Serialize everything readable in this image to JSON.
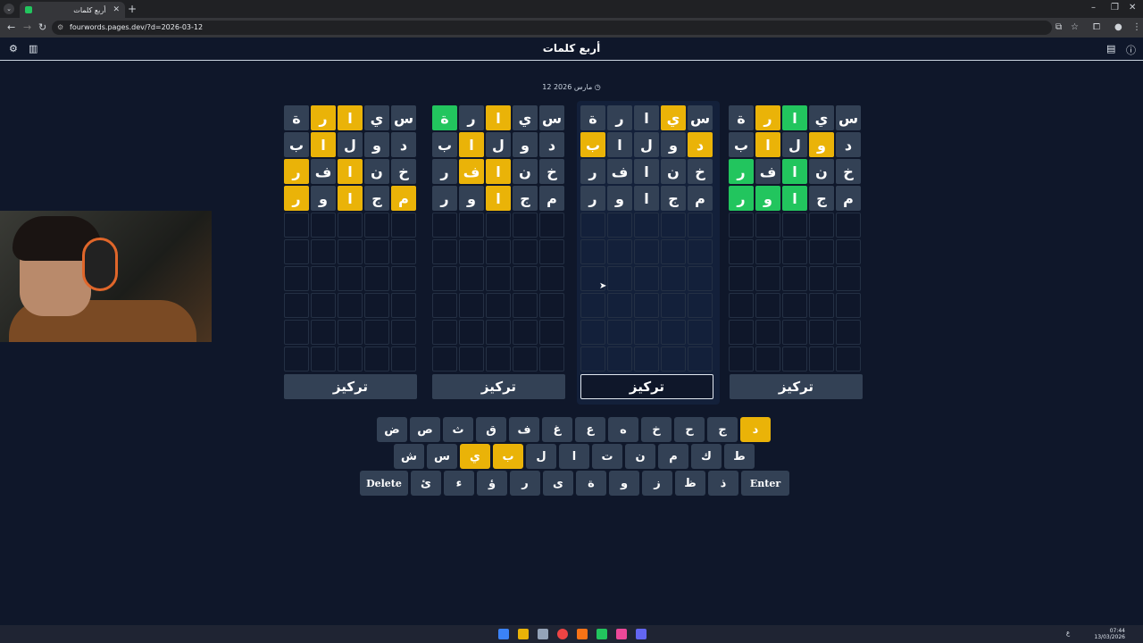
{
  "browser": {
    "tab_title": "أربع كلمات",
    "tab_close": "✕",
    "new_tab": "+",
    "tab_list": "⌄",
    "url": "fourwords.pages.dev/?d=2026-03-12",
    "minimize": "–",
    "restore": "❐",
    "close": "✕"
  },
  "app": {
    "title": "أربع كلمات",
    "date": "12 مارس 2026",
    "focus_label": "تركيز"
  },
  "colors": {
    "green": "#22c55e",
    "yellow": "#eab308",
    "gray": "#334155",
    "bg": "#0f172a"
  },
  "boards": [
    {
      "rows": [
        [
          [
            "س",
            "n"
          ],
          [
            "ي",
            "n"
          ],
          [
            "ا",
            "y"
          ],
          [
            "ر",
            "y"
          ],
          [
            "ة",
            "n"
          ]
        ],
        [
          [
            "د",
            "n"
          ],
          [
            "و",
            "n"
          ],
          [
            "ل",
            "n"
          ],
          [
            "ا",
            "y"
          ],
          [
            "ب",
            "n"
          ]
        ],
        [
          [
            "خ",
            "n"
          ],
          [
            "ن",
            "n"
          ],
          [
            "ا",
            "y"
          ],
          [
            "ف",
            "n"
          ],
          [
            "ر",
            "y"
          ]
        ],
        [
          [
            "م",
            "y"
          ],
          [
            "ج",
            "n"
          ],
          [
            "ا",
            "y"
          ],
          [
            "و",
            "n"
          ],
          [
            "ر",
            "y"
          ]
        ]
      ]
    },
    {
      "rows": [
        [
          [
            "س",
            "n"
          ],
          [
            "ي",
            "n"
          ],
          [
            "ا",
            "y"
          ],
          [
            "ر",
            "n"
          ],
          [
            "ة",
            "g"
          ]
        ],
        [
          [
            "د",
            "n"
          ],
          [
            "و",
            "n"
          ],
          [
            "ل",
            "n"
          ],
          [
            "ا",
            "y"
          ],
          [
            "ب",
            "n"
          ]
        ],
        [
          [
            "خ",
            "n"
          ],
          [
            "ن",
            "n"
          ],
          [
            "ا",
            "y"
          ],
          [
            "ف",
            "y"
          ],
          [
            "ر",
            "n"
          ]
        ],
        [
          [
            "م",
            "n"
          ],
          [
            "ج",
            "n"
          ],
          [
            "ا",
            "y"
          ],
          [
            "و",
            "n"
          ],
          [
            "ر",
            "n"
          ]
        ]
      ]
    },
    {
      "rows": [
        [
          [
            "س",
            "n"
          ],
          [
            "ي",
            "y"
          ],
          [
            "ا",
            "n"
          ],
          [
            "ر",
            "n"
          ],
          [
            "ة",
            "n"
          ]
        ],
        [
          [
            "د",
            "y"
          ],
          [
            "و",
            "n"
          ],
          [
            "ل",
            "n"
          ],
          [
            "ا",
            "n"
          ],
          [
            "ب",
            "y"
          ]
        ],
        [
          [
            "خ",
            "n"
          ],
          [
            "ن",
            "n"
          ],
          [
            "ا",
            "n"
          ],
          [
            "ف",
            "n"
          ],
          [
            "ر",
            "n"
          ]
        ],
        [
          [
            "م",
            "n"
          ],
          [
            "ج",
            "n"
          ],
          [
            "ا",
            "n"
          ],
          [
            "و",
            "n"
          ],
          [
            "ر",
            "n"
          ]
        ]
      ]
    },
    {
      "rows": [
        [
          [
            "س",
            "n"
          ],
          [
            "ي",
            "n"
          ],
          [
            "ا",
            "g"
          ],
          [
            "ر",
            "y"
          ],
          [
            "ة",
            "n"
          ]
        ],
        [
          [
            "د",
            "n"
          ],
          [
            "و",
            "y"
          ],
          [
            "ل",
            "n"
          ],
          [
            "ا",
            "y"
          ],
          [
            "ب",
            "n"
          ]
        ],
        [
          [
            "خ",
            "n"
          ],
          [
            "ن",
            "n"
          ],
          [
            "ا",
            "g"
          ],
          [
            "ف",
            "n"
          ],
          [
            "ر",
            "g"
          ]
        ],
        [
          [
            "م",
            "n"
          ],
          [
            "ج",
            "n"
          ],
          [
            "ا",
            "g"
          ],
          [
            "و",
            "g"
          ],
          [
            "ر",
            "g"
          ]
        ]
      ]
    }
  ],
  "keyboard": {
    "row1": [
      [
        "د",
        "y"
      ],
      [
        "ج",
        "n"
      ],
      [
        "ح",
        "n"
      ],
      [
        "خ",
        "n"
      ],
      [
        "ه",
        "n"
      ],
      [
        "ع",
        "n"
      ],
      [
        "غ",
        "n"
      ],
      [
        "ف",
        "n"
      ],
      [
        "ق",
        "n"
      ],
      [
        "ث",
        "n"
      ],
      [
        "ص",
        "n"
      ],
      [
        "ض",
        "n"
      ]
    ],
    "row2": [
      [
        "ط",
        "n"
      ],
      [
        "ك",
        "n"
      ],
      [
        "م",
        "n"
      ],
      [
        "ن",
        "n"
      ],
      [
        "ت",
        "n"
      ],
      [
        "ا",
        "n"
      ],
      [
        "ل",
        "n"
      ],
      [
        "ب",
        "y"
      ],
      [
        "ي",
        "y"
      ],
      [
        "س",
        "n"
      ],
      [
        "ش",
        "n"
      ]
    ],
    "row3": [
      [
        "Enter",
        "n"
      ],
      [
        "ذ",
        "n"
      ],
      [
        "ظ",
        "n"
      ],
      [
        "ز",
        "n"
      ],
      [
        "و",
        "n"
      ],
      [
        "ة",
        "n"
      ],
      [
        "ى",
        "n"
      ],
      [
        "ر",
        "n"
      ],
      [
        "ؤ",
        "n"
      ],
      [
        "ء",
        "n"
      ],
      [
        "ئ",
        "n"
      ],
      [
        "Delete",
        "n"
      ]
    ]
  },
  "taskbar": {
    "time": "07:44",
    "date": "13/03/2026",
    "lang": "ع"
  }
}
